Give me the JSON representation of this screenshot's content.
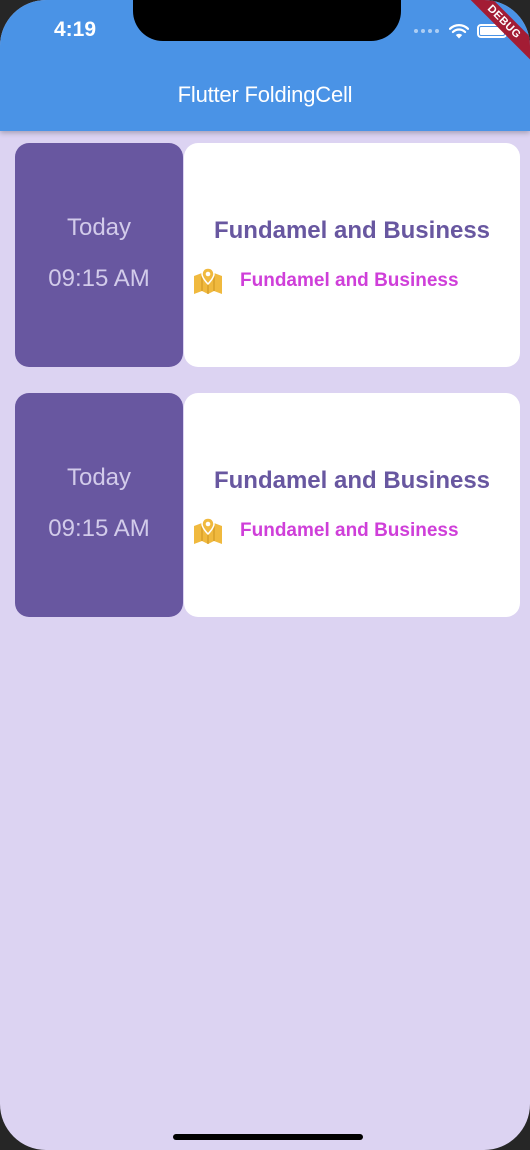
{
  "status_bar": {
    "time": "4:19"
  },
  "app_bar": {
    "title": "Flutter FoldingCell"
  },
  "debug_banner": "DEBUG",
  "cells": [
    {
      "day": "Today",
      "time": "09:15 AM",
      "title": "Fundamel and Business",
      "subtitle": "Fundamel and Business",
      "icon": "map-icon"
    },
    {
      "day": "Today",
      "time": "09:15 AM",
      "title": "Fundamel and Business",
      "subtitle": "Fundamel and Business",
      "icon": "map-icon"
    }
  ],
  "colors": {
    "app_bar": "#4a93e6",
    "background": "#dcd3f2",
    "cell_left": "#6857a0",
    "cell_right": "#ffffff",
    "title_text": "#6857a0",
    "subtitle_text": "#cf3fd9",
    "icon": "#f0b93e"
  }
}
